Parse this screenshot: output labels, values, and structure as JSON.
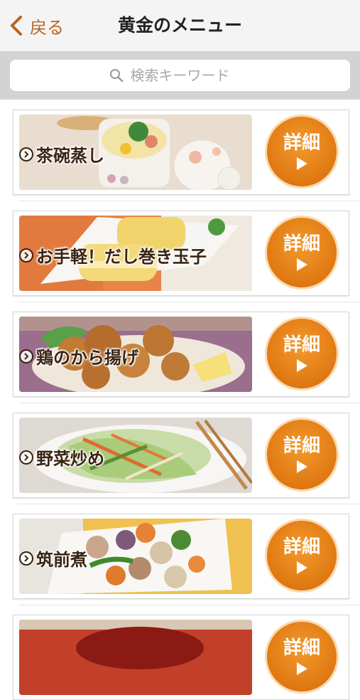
{
  "header": {
    "back_label": "戻る",
    "title": "黄金のメニュー"
  },
  "search": {
    "placeholder": "検索キーワード"
  },
  "menu": {
    "detail_label": "詳細",
    "items": [
      {
        "name": "茶碗蒸し"
      },
      {
        "name": "お手軽！だし巻き玉子"
      },
      {
        "name": "鶏のから揚げ"
      },
      {
        "name": "野菜炒め"
      },
      {
        "name": "筑前煮"
      },
      {
        "name": ""
      }
    ]
  },
  "colors": {
    "accent": "#e07812",
    "back_text": "#b9631e"
  }
}
